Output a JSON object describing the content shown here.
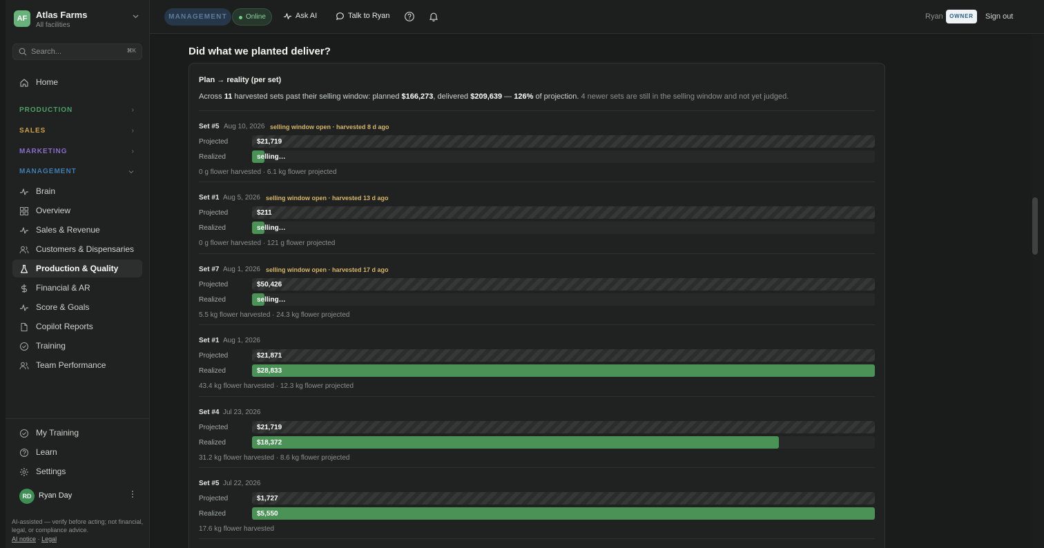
{
  "org": {
    "initials": "AF",
    "name": "Atlas Farms",
    "subtitle": "All facilities"
  },
  "search": {
    "placeholder": "Search...",
    "shortcut": "⌘K"
  },
  "nav": {
    "home": "Home",
    "sections": [
      {
        "label": "PRODUCTION",
        "color": "#4e9f66"
      },
      {
        "label": "SALES",
        "color": "#d0a04a"
      },
      {
        "label": "MARKETING",
        "color": "#8a6cc7"
      },
      {
        "label": "MANAGEMENT",
        "color": "#3f7db0"
      }
    ],
    "management_items": [
      {
        "label": "Brain",
        "icon": "pulse-icon"
      },
      {
        "label": "Overview",
        "icon": "grid-icon"
      },
      {
        "label": "Sales & Revenue",
        "icon": "pulse-icon"
      },
      {
        "label": "Customers & Dispensaries",
        "icon": "users-icon"
      },
      {
        "label": "Production & Quality",
        "icon": "flask-icon",
        "active": true
      },
      {
        "label": "Financial & AR",
        "icon": "dollar-icon"
      },
      {
        "label": "Score & Goals",
        "icon": "pulse-icon"
      },
      {
        "label": "Copilot Reports",
        "icon": "document-icon"
      },
      {
        "label": "Training",
        "icon": "check-circle-icon"
      },
      {
        "label": "Team Performance",
        "icon": "users-icon"
      }
    ],
    "bottom_items": [
      {
        "label": "My Training",
        "icon": "check-circle-icon"
      },
      {
        "label": "Learn",
        "icon": "help-circle-icon"
      },
      {
        "label": "Settings",
        "icon": "gear-icon"
      }
    ]
  },
  "user": {
    "initials": "RD",
    "name": "Ryan Day"
  },
  "footer": {
    "disclaimer": "AI-assisted — verify before acting; not financial, legal, or compliance advice.",
    "ai_notice": "AI notice",
    "separator": "·",
    "legal": "Legal"
  },
  "topbar": {
    "mode": "MANAGEMENT",
    "status": "Online",
    "ask_ai": "Ask AI",
    "talk": "Talk to Ryan",
    "user": "Ryan",
    "role": "OWNER",
    "signout": "Sign out"
  },
  "page": {
    "title": "Did what we planted deliver?",
    "card_title": "Plan → reality (per set)",
    "summary": {
      "p1": "Across ",
      "count": "11",
      "p2": " harvested sets past their selling window: planned ",
      "planned": "$166,273",
      "p3": ", delivered ",
      "delivered": "$209,639",
      "p4": " — ",
      "pct": "126%",
      "p5": " of projection. ",
      "muted": "4 newer sets are still in the selling window and not yet judged."
    },
    "projected_label": "Projected",
    "realized_label": "Realized"
  },
  "sets": [
    {
      "name": "Set #5",
      "date": "Aug 10, 2026",
      "status": "selling window open · harvested 8 d ago",
      "projected": "$21,719",
      "realized": "selling…",
      "realized_fraction": 0.02,
      "foot": "0 g flower harvested · 6.1 kg flower projected"
    },
    {
      "name": "Set #1",
      "date": "Aug 5, 2026",
      "status": "selling window open · harvested 13 d ago",
      "projected": "$211",
      "realized": "selling…",
      "realized_fraction": 0.02,
      "foot": "0 g flower harvested · 121 g flower projected"
    },
    {
      "name": "Set #7",
      "date": "Aug 1, 2026",
      "status": "selling window open · harvested 17 d ago",
      "projected": "$50,426",
      "realized": "selling…",
      "realized_fraction": 0.02,
      "foot": "5.5 kg flower harvested · 24.3 kg flower projected"
    },
    {
      "name": "Set #1",
      "date": "Aug 1, 2026",
      "status": "",
      "projected": "$21,871",
      "realized": "$28,833",
      "realized_fraction": 1.0,
      "foot": "43.4 kg flower harvested · 12.3 kg flower projected"
    },
    {
      "name": "Set #4",
      "date": "Jul 23, 2026",
      "status": "",
      "projected": "$21,719",
      "realized": "$18,372",
      "realized_fraction": 0.846,
      "foot": "31.2 kg flower harvested · 8.6 kg flower projected"
    },
    {
      "name": "Set #5",
      "date": "Jul 22, 2026",
      "status": "",
      "projected": "$1,727",
      "realized": "$5,550",
      "realized_fraction": 1.0,
      "foot": "17.6 kg flower harvested"
    }
  ]
}
